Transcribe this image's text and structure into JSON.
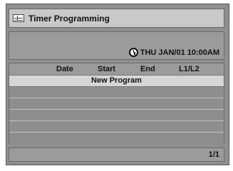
{
  "title": "Timer Programming",
  "clock": {
    "datetime": "THU JAN/01 10:00AM"
  },
  "table": {
    "columns": [
      "Date",
      "Start",
      "End",
      "L1/L2"
    ],
    "rows": [
      {
        "label": "New Program",
        "selected": true
      },
      {
        "label": ""
      },
      {
        "label": ""
      },
      {
        "label": ""
      },
      {
        "label": ""
      },
      {
        "label": ""
      }
    ]
  },
  "footer": {
    "page": "1/1"
  },
  "icons": {
    "title": "grid-icon",
    "clock": "clock-icon"
  }
}
